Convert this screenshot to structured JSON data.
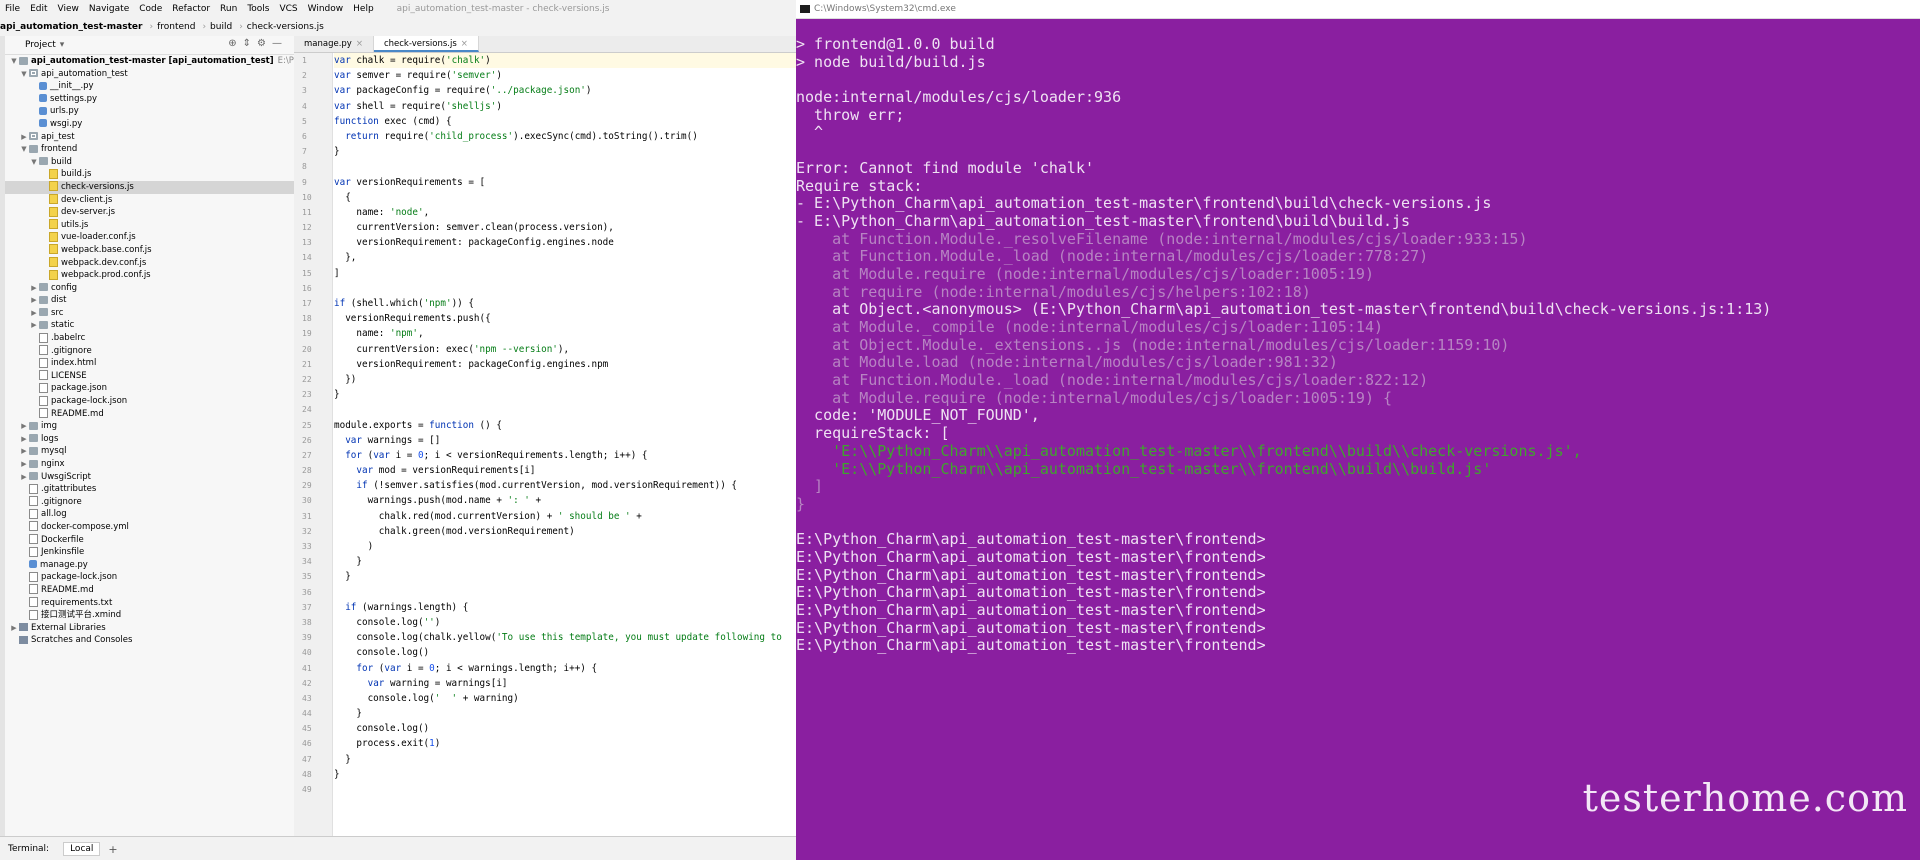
{
  "menubar": {
    "items": [
      "File",
      "Edit",
      "View",
      "Navigate",
      "Code",
      "Refactor",
      "Run",
      "Tools",
      "VCS",
      "Window",
      "Help"
    ],
    "window_title": "api_automation_test-master - check-versions.js"
  },
  "breadcrumb": [
    "api_automation_test-master",
    "frontend",
    "build",
    "check-versions.js"
  ],
  "project": {
    "title": "Project",
    "tree": [
      {
        "label": "api_automation_test-master [api_automation_test]",
        "hint": "E:\\Python_Charm\\a",
        "depth": 0,
        "type": "folder",
        "expanded": true
      },
      {
        "label": "api_automation_test",
        "depth": 1,
        "type": "pkg",
        "expanded": true
      },
      {
        "label": "__init__.py",
        "depth": 2,
        "type": "py"
      },
      {
        "label": "settings.py",
        "depth": 2,
        "type": "py"
      },
      {
        "label": "urls.py",
        "depth": 2,
        "type": "py"
      },
      {
        "label": "wsgi.py",
        "depth": 2,
        "type": "py"
      },
      {
        "label": "api_test",
        "depth": 1,
        "type": "pkg",
        "expanded": false
      },
      {
        "label": "frontend",
        "depth": 1,
        "type": "folder",
        "expanded": true
      },
      {
        "label": "build",
        "depth": 2,
        "type": "folder",
        "expanded": true
      },
      {
        "label": "build.js",
        "depth": 3,
        "type": "js"
      },
      {
        "label": "check-versions.js",
        "depth": 3,
        "type": "js",
        "selected": true
      },
      {
        "label": "dev-client.js",
        "depth": 3,
        "type": "js"
      },
      {
        "label": "dev-server.js",
        "depth": 3,
        "type": "js"
      },
      {
        "label": "utils.js",
        "depth": 3,
        "type": "js"
      },
      {
        "label": "vue-loader.conf.js",
        "depth": 3,
        "type": "js"
      },
      {
        "label": "webpack.base.conf.js",
        "depth": 3,
        "type": "js"
      },
      {
        "label": "webpack.dev.conf.js",
        "depth": 3,
        "type": "js"
      },
      {
        "label": "webpack.prod.conf.js",
        "depth": 3,
        "type": "js"
      },
      {
        "label": "config",
        "depth": 2,
        "type": "folder",
        "expanded": false
      },
      {
        "label": "dist",
        "depth": 2,
        "type": "folder",
        "expanded": false
      },
      {
        "label": "src",
        "depth": 2,
        "type": "folder",
        "expanded": false
      },
      {
        "label": "static",
        "depth": 2,
        "type": "folder",
        "expanded": false
      },
      {
        "label": ".babelrc",
        "depth": 2,
        "type": "file"
      },
      {
        "label": ".gitignore",
        "depth": 2,
        "type": "file"
      },
      {
        "label": "index.html",
        "depth": 2,
        "type": "file"
      },
      {
        "label": "LICENSE",
        "depth": 2,
        "type": "file"
      },
      {
        "label": "package.json",
        "depth": 2,
        "type": "file"
      },
      {
        "label": "package-lock.json",
        "depth": 2,
        "type": "file"
      },
      {
        "label": "README.md",
        "depth": 2,
        "type": "file"
      },
      {
        "label": "img",
        "depth": 1,
        "type": "folder",
        "expanded": false
      },
      {
        "label": "logs",
        "depth": 1,
        "type": "folder",
        "expanded": false
      },
      {
        "label": "mysql",
        "depth": 1,
        "type": "folder",
        "expanded": false
      },
      {
        "label": "nginx",
        "depth": 1,
        "type": "folder",
        "expanded": false
      },
      {
        "label": "UwsgiScript",
        "depth": 1,
        "type": "folder",
        "expanded": false
      },
      {
        "label": ".gitattributes",
        "depth": 1,
        "type": "file"
      },
      {
        "label": ".gitignore",
        "depth": 1,
        "type": "file"
      },
      {
        "label": "all.log",
        "depth": 1,
        "type": "file"
      },
      {
        "label": "docker-compose.yml",
        "depth": 1,
        "type": "file"
      },
      {
        "label": "Dockerfile",
        "depth": 1,
        "type": "file"
      },
      {
        "label": "Jenkinsfile",
        "depth": 1,
        "type": "file"
      },
      {
        "label": "manage.py",
        "depth": 1,
        "type": "py"
      },
      {
        "label": "package-lock.json",
        "depth": 1,
        "type": "file"
      },
      {
        "label": "README.md",
        "depth": 1,
        "type": "file"
      },
      {
        "label": "requirements.txt",
        "depth": 1,
        "type": "file"
      },
      {
        "label": "接口测试平台.xmind",
        "depth": 1,
        "type": "file"
      },
      {
        "label": "External Libraries",
        "depth": 0,
        "type": "lib",
        "expanded": false
      },
      {
        "label": "Scratches and Consoles",
        "depth": 0,
        "type": "lib"
      }
    ]
  },
  "editor": {
    "tabs": [
      {
        "label": "manage.py",
        "active": false
      },
      {
        "label": "check-versions.js",
        "active": true
      }
    ],
    "lines": [
      [
        [
          "var ",
          "kw"
        ],
        [
          "chalk",
          "p"
        ],
        [
          " = require(",
          "p"
        ],
        [
          "'chalk'",
          "s"
        ],
        [
          ")",
          "p"
        ]
      ],
      [
        [
          "var ",
          "kw"
        ],
        [
          "semver = require(",
          "p"
        ],
        [
          "'semver'",
          "s"
        ],
        [
          ")",
          "p"
        ]
      ],
      [
        [
          "var ",
          "kw"
        ],
        [
          "packageConfig = require(",
          "p"
        ],
        [
          "'../package.json'",
          "s"
        ],
        [
          ")",
          "p"
        ]
      ],
      [
        [
          "var ",
          "kw"
        ],
        [
          "shell = require(",
          "p"
        ],
        [
          "'shelljs'",
          "s"
        ],
        [
          ")",
          "p"
        ]
      ],
      [
        [
          "function ",
          "kw"
        ],
        [
          "exec (cmd) {",
          "p"
        ]
      ],
      [
        [
          "  ",
          "p"
        ],
        [
          "return ",
          "kw"
        ],
        [
          "require(",
          "p"
        ],
        [
          "'child_process'",
          "s"
        ],
        [
          ").execSync(cmd).toString().trim()",
          "p"
        ]
      ],
      [
        [
          "}",
          "p"
        ]
      ],
      [
        [
          "",
          "p"
        ]
      ],
      [
        [
          "var ",
          "kw"
        ],
        [
          "versionRequirements = [",
          "p"
        ]
      ],
      [
        [
          "  {",
          "p"
        ]
      ],
      [
        [
          "    name: ",
          "p"
        ],
        [
          "'node'",
          "s"
        ],
        [
          ",",
          "p"
        ]
      ],
      [
        [
          "    currentVersion: semver.clean(process.version),",
          "p"
        ]
      ],
      [
        [
          "    versionRequirement: packageConfig.engines.node",
          "p"
        ]
      ],
      [
        [
          "  },",
          "p"
        ]
      ],
      [
        [
          "]",
          "p"
        ]
      ],
      [
        [
          "",
          "p"
        ]
      ],
      [
        [
          "if ",
          "kw"
        ],
        [
          "(shell.which(",
          "p"
        ],
        [
          "'npm'",
          "s"
        ],
        [
          ")) {",
          "p"
        ]
      ],
      [
        [
          "  versionRequirements.push({",
          "p"
        ]
      ],
      [
        [
          "    name: ",
          "p"
        ],
        [
          "'npm'",
          "s"
        ],
        [
          ",",
          "p"
        ]
      ],
      [
        [
          "    currentVersion: exec(",
          "p"
        ],
        [
          "'npm --version'",
          "s"
        ],
        [
          "),",
          "p"
        ]
      ],
      [
        [
          "    versionRequirement: packageConfig.engines.npm",
          "p"
        ]
      ],
      [
        [
          "  })",
          "p"
        ]
      ],
      [
        [
          "}",
          "p"
        ]
      ],
      [
        [
          "",
          "p"
        ]
      ],
      [
        [
          "module.exports = ",
          "p"
        ],
        [
          "function ",
          "kw"
        ],
        [
          "() {",
          "p"
        ]
      ],
      [
        [
          "  ",
          "p"
        ],
        [
          "var ",
          "kw"
        ],
        [
          "warnings = []",
          "p"
        ]
      ],
      [
        [
          "  ",
          "p"
        ],
        [
          "for ",
          "kw"
        ],
        [
          "(",
          "p"
        ],
        [
          "var ",
          "kw"
        ],
        [
          "i = ",
          "p"
        ],
        [
          "0",
          "n"
        ],
        [
          "; i < versionRequirements.length; i++) {",
          "p"
        ]
      ],
      [
        [
          "    ",
          "p"
        ],
        [
          "var ",
          "kw"
        ],
        [
          "mod = versionRequirements[i]",
          "p"
        ]
      ],
      [
        [
          "    ",
          "p"
        ],
        [
          "if ",
          "kw"
        ],
        [
          "(!semver.satisfies(mod.currentVersion, mod.versionRequirement)) {",
          "p"
        ]
      ],
      [
        [
          "      warnings.push(mod.name + ",
          "p"
        ],
        [
          "': '",
          "s"
        ],
        [
          " +",
          "p"
        ]
      ],
      [
        [
          "        chalk.red(mod.currentVersion) + ",
          "p"
        ],
        [
          "' should be '",
          "s"
        ],
        [
          " +",
          "p"
        ]
      ],
      [
        [
          "        chalk.green(mod.versionRequirement)",
          "p"
        ]
      ],
      [
        [
          "      )",
          "p"
        ]
      ],
      [
        [
          "    }",
          "p"
        ]
      ],
      [
        [
          "  }",
          "p"
        ]
      ],
      [
        [
          "",
          "p"
        ]
      ],
      [
        [
          "  ",
          "p"
        ],
        [
          "if ",
          "kw"
        ],
        [
          "(warnings.length) {",
          "p"
        ]
      ],
      [
        [
          "    console.log(",
          "p"
        ],
        [
          "''",
          "s"
        ],
        [
          ")",
          "p"
        ]
      ],
      [
        [
          "    console.log(chalk.yellow(",
          "p"
        ],
        [
          "'To use this template, you must update following to",
          "s"
        ]
      ],
      [
        [
          "    console.log()",
          "p"
        ]
      ],
      [
        [
          "    ",
          "p"
        ],
        [
          "for ",
          "kw"
        ],
        [
          "(",
          "p"
        ],
        [
          "var ",
          "kw"
        ],
        [
          "i = ",
          "p"
        ],
        [
          "0",
          "n"
        ],
        [
          "; i < warnings.length; i++) {",
          "p"
        ]
      ],
      [
        [
          "      ",
          "p"
        ],
        [
          "var ",
          "kw"
        ],
        [
          "warning = warnings[i]",
          "p"
        ]
      ],
      [
        [
          "      console.log(",
          "p"
        ],
        [
          "'  '",
          "s"
        ],
        [
          " + warning)",
          "p"
        ]
      ],
      [
        [
          "    }",
          "p"
        ]
      ],
      [
        [
          "    console.log()",
          "p"
        ]
      ],
      [
        [
          "    process.exit(",
          "p"
        ],
        [
          "1",
          "n"
        ],
        [
          ")",
          "p"
        ]
      ],
      [
        [
          "  }",
          "p"
        ]
      ],
      [
        [
          "}",
          "p"
        ]
      ],
      [
        [
          "",
          "p"
        ]
      ]
    ]
  },
  "bottombar": {
    "terminal": "Terminal:",
    "local": "Local",
    "plus": "+"
  },
  "cmd": {
    "title": "C:\\Windows\\System32\\cmd.exe",
    "lines": [
      {
        "t": "> frontend@1.0.0 build",
        "c": ""
      },
      {
        "t": "> node build/build.js",
        "c": ""
      },
      {
        "t": "",
        "c": ""
      },
      {
        "t": "node:internal/modules/cjs/loader:936",
        "c": ""
      },
      {
        "t": "  throw err;",
        "c": ""
      },
      {
        "t": "  ^",
        "c": ""
      },
      {
        "t": "",
        "c": ""
      },
      {
        "t": "Error: Cannot find module 'chalk'",
        "c": ""
      },
      {
        "t": "Require stack:",
        "c": ""
      },
      {
        "t": "- E:\\Python_Charm\\api_automation_test-master\\frontend\\build\\check-versions.js",
        "c": ""
      },
      {
        "t": "- E:\\Python_Charm\\api_automation_test-master\\frontend\\build\\build.js",
        "c": ""
      },
      {
        "t": "    at Function.Module._resolveFilename (node:internal/modules/cjs/loader:933:15)",
        "c": "dim"
      },
      {
        "t": "    at Function.Module._load (node:internal/modules/cjs/loader:778:27)",
        "c": "dim"
      },
      {
        "t": "    at Module.require (node:internal/modules/cjs/loader:1005:19)",
        "c": "dim"
      },
      {
        "t": "    at require (node:internal/modules/cjs/helpers:102:18)",
        "c": "dim"
      },
      {
        "t": "    at Object.<anonymous> (E:\\Python_Charm\\api_automation_test-master\\frontend\\build\\check-versions.js:1:13)",
        "c": ""
      },
      {
        "t": "    at Module._compile (node:internal/modules/cjs/loader:1105:14)",
        "c": "dim"
      },
      {
        "t": "    at Object.Module._extensions..js (node:internal/modules/cjs/loader:1159:10)",
        "c": "dim"
      },
      {
        "t": "    at Module.load (node:internal/modules/cjs/loader:981:32)",
        "c": "dim"
      },
      {
        "t": "    at Function.Module._load (node:internal/modules/cjs/loader:822:12)",
        "c": "dim"
      },
      {
        "t": "    at Module.require (node:internal/modules/cjs/loader:1005:19) {",
        "c": "dim"
      },
      {
        "t": "  code: 'MODULE_NOT_FOUND',",
        "c": ""
      },
      {
        "t": "  requireStack: [",
        "c": ""
      },
      {
        "t": "    'E:\\\\Python_Charm\\\\api_automation_test-master\\\\frontend\\\\build\\\\check-versions.js',",
        "c": "str"
      },
      {
        "t": "    'E:\\\\Python_Charm\\\\api_automation_test-master\\\\frontend\\\\build\\\\build.js'",
        "c": "str"
      },
      {
        "t": "  ]",
        "c": "dim"
      },
      {
        "t": "}",
        "c": "dim"
      },
      {
        "t": "",
        "c": ""
      },
      {
        "t": "E:\\Python_Charm\\api_automation_test-master\\frontend>",
        "c": ""
      },
      {
        "t": "E:\\Python_Charm\\api_automation_test-master\\frontend>",
        "c": ""
      },
      {
        "t": "E:\\Python_Charm\\api_automation_test-master\\frontend>",
        "c": ""
      },
      {
        "t": "E:\\Python_Charm\\api_automation_test-master\\frontend>",
        "c": ""
      },
      {
        "t": "E:\\Python_Charm\\api_automation_test-master\\frontend>",
        "c": ""
      },
      {
        "t": "E:\\Python_Charm\\api_automation_test-master\\frontend>",
        "c": ""
      },
      {
        "t": "E:\\Python_Charm\\api_automation_test-master\\frontend>",
        "c": ""
      }
    ],
    "watermark": "testerhome.com"
  },
  "colors": {
    "keyword": "#0033b3",
    "string": "#067d17",
    "number": "#1750eb",
    "terminal_bg": "#8a1fa0"
  }
}
